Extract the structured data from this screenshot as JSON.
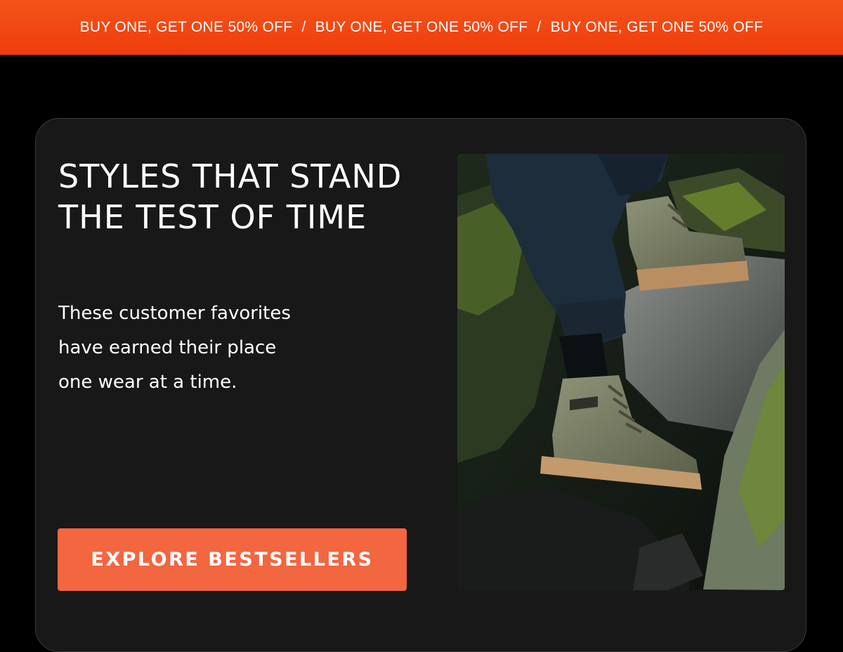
{
  "promo_banner": {
    "messages": [
      "BUY ONE, GET ONE 50% OFF",
      "BUY ONE, GET ONE 50% OFF",
      "BUY ONE, GET ONE 50% OFF"
    ],
    "separator": "/",
    "color": "#f04a12"
  },
  "hero": {
    "headline": "STYLES THAT STAND THE TEST OF TIME",
    "subcopy_lines": [
      "These customer favorites",
      "have earned their place",
      "one wear at a time."
    ],
    "cta_label": "EXPLORE BESTSELLERS",
    "cta_color": "#f26640",
    "card_color": "#181818"
  }
}
